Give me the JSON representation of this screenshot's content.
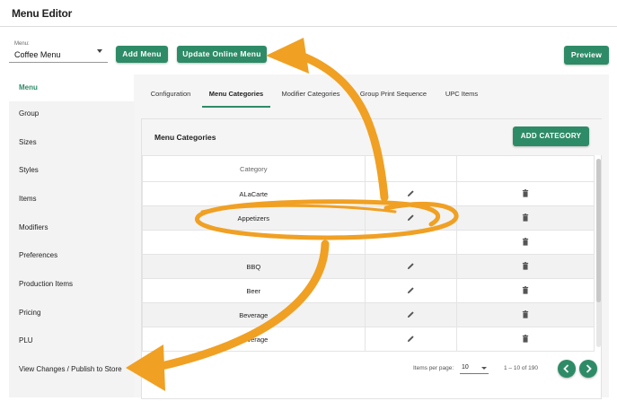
{
  "header": {
    "title": "Menu Editor"
  },
  "menu_select": {
    "label": "Menu:",
    "value": "Coffee Menu"
  },
  "toolbar": {
    "add_menu": "Add Menu",
    "update_online": "Update Online Menu",
    "preview": "Preview"
  },
  "sidebar": {
    "items": [
      {
        "label": "Menu"
      },
      {
        "label": "Group"
      },
      {
        "label": "Sizes"
      },
      {
        "label": "Styles"
      },
      {
        "label": "Items"
      },
      {
        "label": "Modifiers"
      },
      {
        "label": "Preferences"
      },
      {
        "label": "Production Items"
      },
      {
        "label": "Pricing"
      },
      {
        "label": "PLU"
      },
      {
        "label": "View Changes / Publish to Store"
      }
    ]
  },
  "tabs": [
    {
      "label": "Configuration"
    },
    {
      "label": "Menu Categories"
    },
    {
      "label": "Modifier Categories"
    },
    {
      "label": "Group Print Sequence"
    },
    {
      "label": "UPC Items"
    }
  ],
  "card": {
    "title": "Menu Categories",
    "add_button": "ADD CATEGORY"
  },
  "table": {
    "header": "Category",
    "rows": [
      "ALaCarte",
      "Appetizers",
      "",
      "BBQ",
      "Beer",
      "Beverage",
      "Beverage"
    ]
  },
  "pager": {
    "items_per_page_label": "Items per page:",
    "items_per_page": "10",
    "range": "1 – 10 of 190"
  },
  "colors": {
    "accent": "#2e8b67",
    "annotation": "#f0a023"
  },
  "icons": {
    "edit": "pencil-icon",
    "delete": "trash-icon",
    "prev": "chevron-left-icon",
    "next": "chevron-right-icon"
  }
}
